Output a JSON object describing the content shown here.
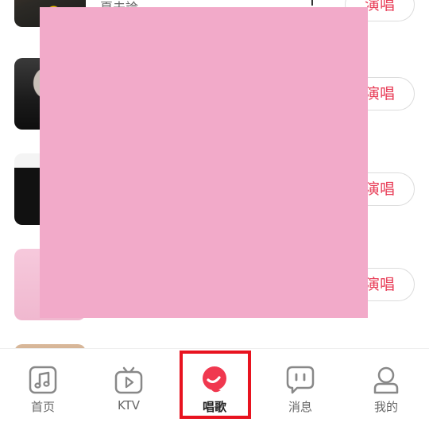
{
  "song_list": {
    "rows": [
      {
        "title": "夏夫論",
        "sing_label": "演唱"
      },
      {
        "title": "",
        "sing_label": "演唱"
      },
      {
        "title": "",
        "sing_label": "演唱"
      },
      {
        "title": "",
        "sing_label": "演唱"
      },
      {
        "title": "",
        "sing_label": ""
      }
    ]
  },
  "tabbar": {
    "items": [
      {
        "label": "首页",
        "icon": "music-note-icon",
        "active": false
      },
      {
        "label": "KTV",
        "icon": "tv-play-icon",
        "active": false
      },
      {
        "label": "唱歌",
        "icon": "sing-logo-icon",
        "active": true
      },
      {
        "label": "消息",
        "icon": "message-icon",
        "active": false
      },
      {
        "label": "我的",
        "icon": "profile-icon",
        "active": false
      }
    ]
  },
  "colors": {
    "accent": "#e83d57",
    "overlay": "#f2aac9",
    "highlight": "#e8131f"
  }
}
